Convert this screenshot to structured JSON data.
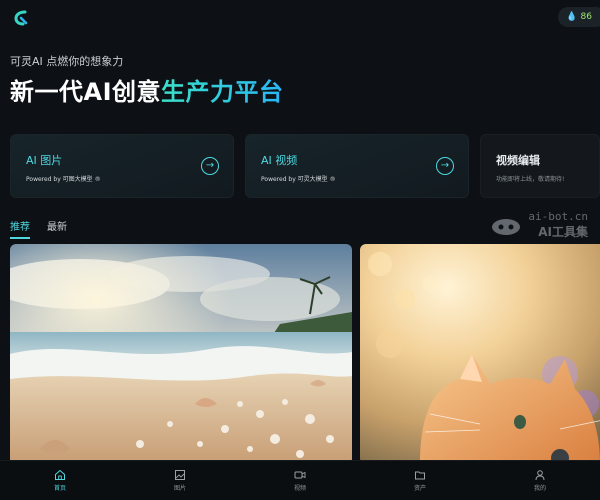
{
  "header": {
    "logo_icon": "kling-logo-icon",
    "credits_icon": "drop-icon",
    "credits_value": "86"
  },
  "hero": {
    "tagline": "可灵AI 点燃你的想象力",
    "title_white": "新一代AI创意",
    "title_gradient": "生产力平台"
  },
  "cards": [
    {
      "title": "AI 图片",
      "subtitle": "Powered by 可图大模型 ®",
      "action_icon": "arrow-right-icon"
    },
    {
      "title": "AI 视频",
      "subtitle": "Powered by 可灵大模型 ®",
      "action_icon": "arrow-right-icon"
    },
    {
      "title": "视频编辑",
      "subtitle": "功能即将上线，敬请期待!"
    }
  ],
  "tabs": [
    {
      "label": "推荐",
      "active": true
    },
    {
      "label": "最新",
      "active": false
    }
  ],
  "watermark": {
    "line1": "ai-bot.cn",
    "line2": "AI工具集"
  },
  "gallery": [
    {
      "subject": "seashell-beach-sunset-image"
    },
    {
      "subject": "orange-kitten-in-sunlight-image"
    }
  ],
  "bottom_nav": [
    {
      "label": "首页",
      "icon": "home-icon",
      "active": true
    },
    {
      "label": "图片",
      "icon": "image-icon",
      "active": false
    },
    {
      "label": "视频",
      "icon": "video-icon",
      "active": false
    },
    {
      "label": "资产",
      "icon": "folder-icon",
      "active": false
    },
    {
      "label": "我的",
      "icon": "user-icon",
      "active": false
    }
  ],
  "colors": {
    "background": "#0d1014",
    "accent": "#4fd8e0",
    "card": "#17242a",
    "credits_text": "#9fe870"
  }
}
